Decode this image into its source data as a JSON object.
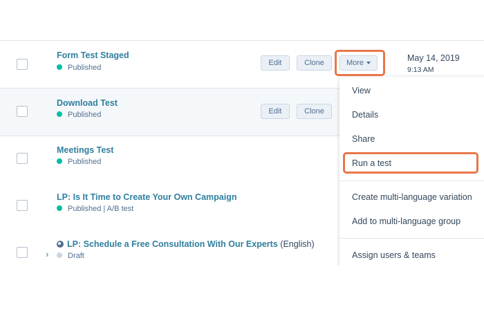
{
  "rows": [
    {
      "title": "Form Test Staged",
      "status": "Published"
    },
    {
      "title": "Download Test",
      "status": "Published"
    },
    {
      "title": "Meetings Test",
      "status": "Published"
    },
    {
      "title": "LP: Is It Time to Create Your Own Campaign",
      "status": "Published | A/B test"
    },
    {
      "title": "LP: Schedule a Free Consultation With Our Experts",
      "language": "(English)",
      "status": "Draft"
    }
  ],
  "actions": {
    "edit": "Edit",
    "clone": "Clone",
    "more": "More"
  },
  "date": {
    "day": "May 14, 2019",
    "time": "9:13 AM"
  },
  "menu": {
    "items": [
      "View",
      "Details",
      "Share",
      "Run a test",
      "Create multi-language variation",
      "Add to multi-language group",
      "Assign users & teams"
    ]
  },
  "colors": {
    "highlight": "#e8764a",
    "link": "#2f7f9e",
    "published": "#00bda5",
    "draft": "#cbd6e2"
  }
}
